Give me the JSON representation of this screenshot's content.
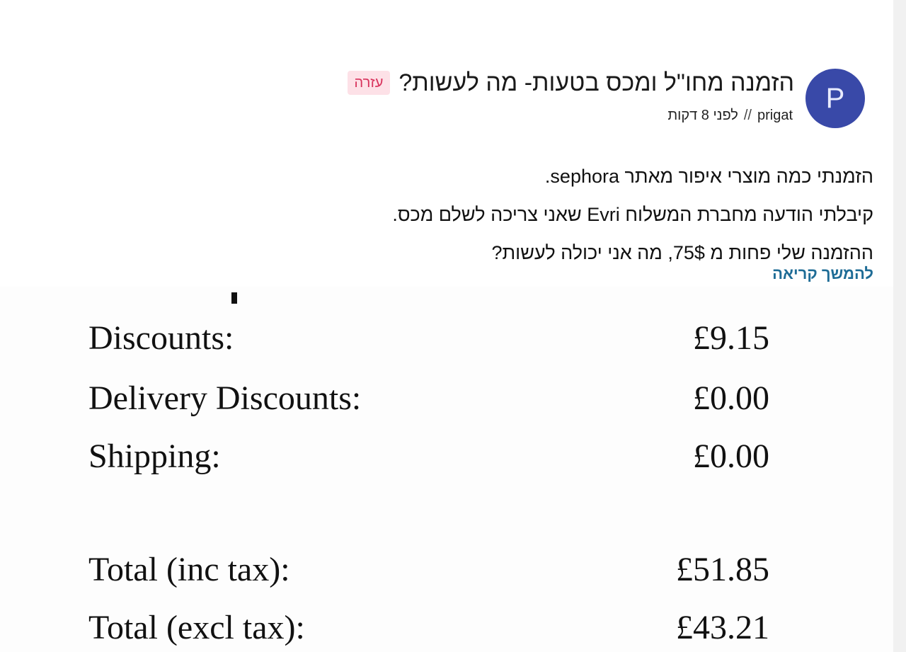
{
  "post": {
    "avatar_letter": "P",
    "badge": "עזרה",
    "title": "הזמנה מחו\"ל ומכס בטעות- מה לעשות?",
    "author": "prigat",
    "separator": "//",
    "time": "לפני 8 דקות",
    "body_lines": [
      "הזמנתי כמה מוצרי איפור מאתר sephora.",
      "קיבלתי הודעה מחברת המשלוח Evri שאני צריכה לשלם מכס.",
      "ההזמנה שלי פחות מ 75$, מה אני יכולה לעשות?"
    ],
    "read_more": "להמשך קריאה"
  },
  "receipt": {
    "rows": [
      {
        "label": "Discounts:",
        "amount": "£9.15"
      },
      {
        "label": "Delivery Discounts:",
        "amount": "£0.00"
      },
      {
        "label": "Shipping:",
        "amount": "£0.00"
      },
      {
        "label": "Total (inc tax):",
        "amount": "£51.85"
      },
      {
        "label": "Total (excl tax):",
        "amount": "£43.21"
      }
    ]
  },
  "colors": {
    "avatar_bg": "#3949a8",
    "badge_bg": "#fde1e7",
    "badge_text": "#d8315b",
    "link": "#1e6c96"
  }
}
